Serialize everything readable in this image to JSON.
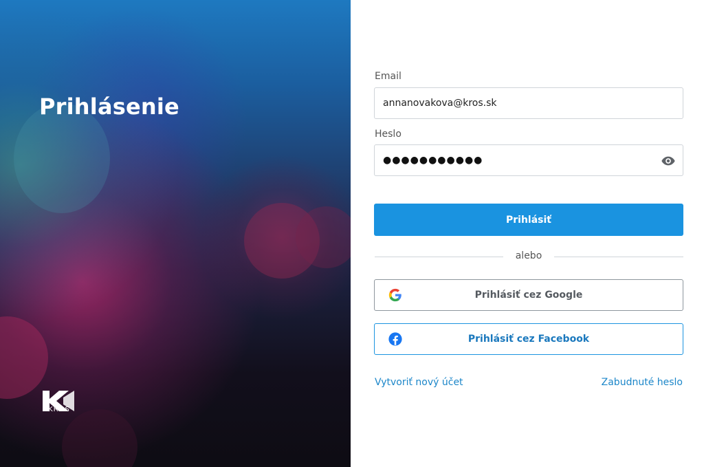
{
  "hero": {
    "title": "Prihlásenie",
    "logo_text": "KROS",
    "logo_icon": "kros-logo"
  },
  "form": {
    "email_label": "Email",
    "email_value": "annanovakova@kros.sk",
    "password_label": "Heslo",
    "password_value": "●●●●●●●●●●●",
    "password_toggle_icon": "eye-icon",
    "submit_label": "Prihlásiť",
    "divider_text": "alebo",
    "google_label": "Prihlásiť cez Google",
    "google_icon": "google-icon",
    "facebook_label": "Prihlásiť cez Facebook",
    "facebook_icon": "facebook-icon",
    "create_account_label": "Vytvoriť nový účet",
    "forgot_password_label": "Zabudnuté heslo"
  },
  "colors": {
    "primary": "#1a93e0",
    "link": "#1b86c9",
    "border": "#cfd4d9"
  }
}
